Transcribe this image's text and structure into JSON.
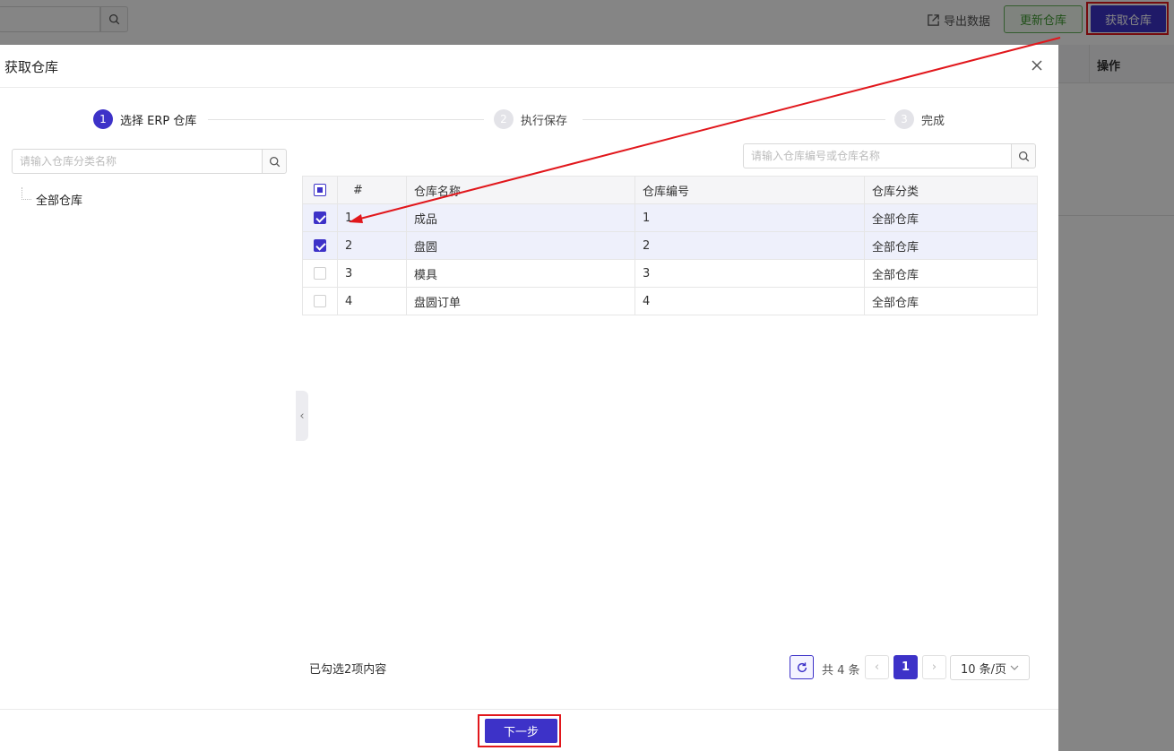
{
  "background": {
    "export_label": "导出数据",
    "update_button": "更新仓库",
    "fetch_button": "获取仓库",
    "column_header": "操作"
  },
  "modal": {
    "title": "获取仓库",
    "steps": [
      {
        "num": "1",
        "label": "选择 ERP 仓库",
        "state": "active"
      },
      {
        "num": "2",
        "label": "执行保存",
        "state": "inactive"
      },
      {
        "num": "3",
        "label": "完成",
        "state": "inactive"
      }
    ],
    "tree": {
      "search_placeholder": "请输入仓库分类名称",
      "root_node": "全部仓库"
    },
    "table": {
      "search_placeholder": "请输入仓库编号或仓库名称",
      "headers": [
        "#",
        "仓库名称",
        "仓库编号",
        "仓库分类"
      ],
      "rows": [
        {
          "checked": true,
          "index": "1",
          "name": "成品",
          "code": "1",
          "category": "全部仓库"
        },
        {
          "checked": true,
          "index": "2",
          "name": "盘圆",
          "code": "2",
          "category": "全部仓库"
        },
        {
          "checked": false,
          "index": "3",
          "name": "模具",
          "code": "3",
          "category": "全部仓库"
        },
        {
          "checked": false,
          "index": "4",
          "name": "盘圆订单",
          "code": "4",
          "category": "全部仓库"
        }
      ]
    },
    "selected_info": "已勾选2项内容",
    "pagination": {
      "total": "共 4 条",
      "current_page": "1",
      "page_size": "10 条/页"
    },
    "next_button": "下一步"
  },
  "colors": {
    "primary": "#3d32c8",
    "annotation_red": "#e1171c",
    "success_green": "#3f9a31"
  }
}
